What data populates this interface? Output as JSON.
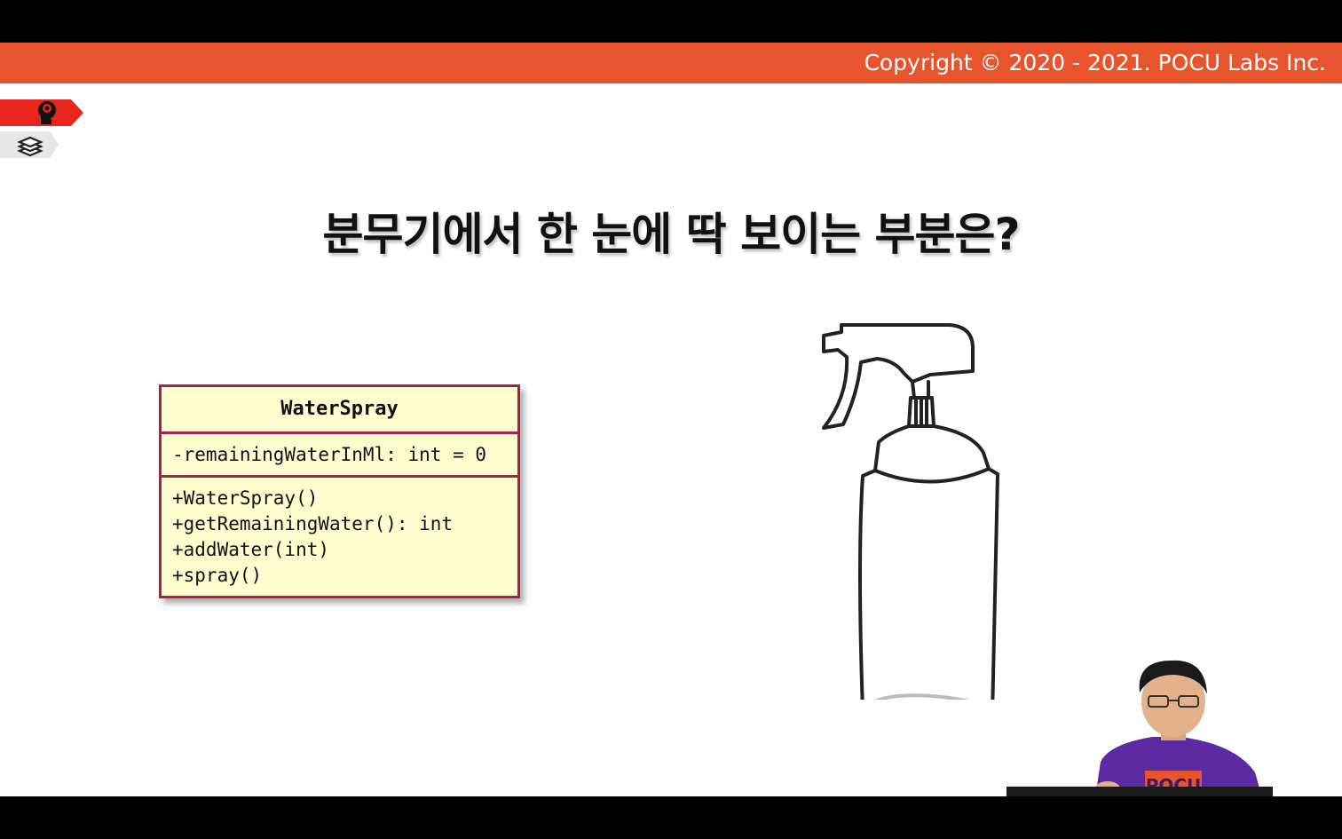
{
  "header": {
    "copyright": "Copyright © 2020 - 2021. POCU Labs Inc.",
    "accent_color": "#e8542e"
  },
  "side_tabs": [
    {
      "icon": "brain-head-icon",
      "color": "#e8261e"
    },
    {
      "icon": "books-stack-icon",
      "color": "#e6e6e6"
    }
  ],
  "slide": {
    "title": "분무기에서 한 눈에 딱 보이는 부분은?"
  },
  "uml": {
    "class_name": "WaterSpray",
    "attributes": [
      "-remainingWaterInMl: int = 0"
    ],
    "methods": [
      "+WaterSpray()",
      "+getRemainingWater(): int",
      "+addWater(int)",
      "+spray()"
    ],
    "fill_color": "#fefece",
    "border_color": "#a8204e"
  },
  "illustration": {
    "icon": "spray-bottle-icon"
  },
  "presenter": {
    "shirt_text": "POCU",
    "shirt_color": "#5b2aa0"
  }
}
